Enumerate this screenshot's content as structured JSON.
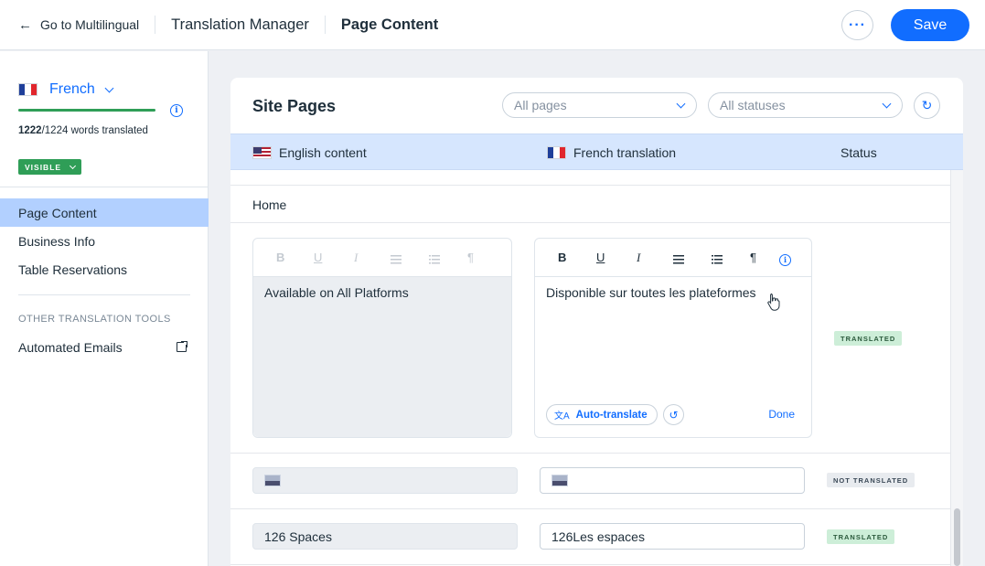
{
  "header": {
    "back_label": "Go to Multilingual",
    "app_title": "Translation Manager",
    "current_page": "Page Content",
    "save_label": "Save"
  },
  "sidebar": {
    "language": "French",
    "words_done": "1222",
    "words_total": "/1224 words translated",
    "progress_fraction": 0.998,
    "visibility": "VISIBLE",
    "items": [
      {
        "label": "Page Content",
        "selected": true
      },
      {
        "label": "Business Info",
        "selected": false
      },
      {
        "label": "Table Reservations",
        "selected": false
      }
    ],
    "tools_heading": "OTHER TRANSLATION TOOLS",
    "tools": [
      {
        "label": "Automated Emails"
      }
    ]
  },
  "main": {
    "title": "Site Pages",
    "filter_pages": "All pages",
    "filter_statuses": "All statuses",
    "columns": {
      "source": "English content",
      "target": "French translation",
      "status": "Status"
    },
    "group": "Home",
    "editor": {
      "source_text": "Available on All Platforms",
      "target_text": "Disponible sur toutes les plateformes",
      "auto_translate": "Auto-translate",
      "done": "Done",
      "status": "TRANSLATED"
    },
    "rows": [
      {
        "source": "",
        "target": "",
        "status": "NOT TRANSLATED",
        "image": true
      },
      {
        "source": "126 Spaces",
        "target": "126Les espaces",
        "status": "TRANSLATED",
        "image": false
      }
    ]
  },
  "colors": {
    "accent": "#116dff",
    "selected_nav": "#b2d0ff",
    "table_header": "#d6e6fe",
    "success": "#2f9e57"
  }
}
